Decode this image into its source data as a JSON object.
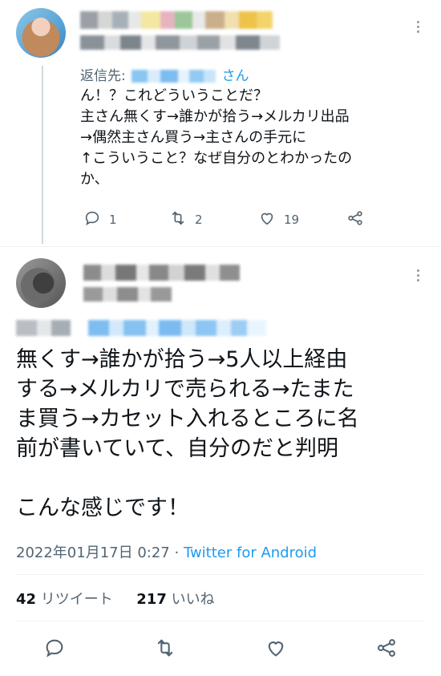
{
  "reply_tweet": {
    "reply_prefix": "返信先:",
    "reply_suffix": "さん",
    "text": "ん！？これどういうことだ？\n主さん無くす→誰かが拾う→メルカリ出品\n→偶然主さん買う→主さんの手元に\n↑こういうこと？なぜ自分のとわかったの\nか、",
    "actions": {
      "reply_count": "1",
      "retweet_count": "2",
      "like_count": "19"
    }
  },
  "main_tweet": {
    "text": "無くす→誰かが拾う→5人以上経由\nする→メルカリで売られる→たまた\nま買う→カセット入れるところに名\n前が書いていて、自分のだと判明\n\nこんな感じです！",
    "timestamp": "2022年01月17日 0:27 · ",
    "source": "Twitter for Android",
    "retweets_count": "42",
    "retweets_label": "リツイート",
    "likes_count": "217",
    "likes_label": "いいね"
  },
  "icons": {
    "reply": "reply-icon",
    "retweet": "retweet-icon",
    "like": "heart-icon",
    "share": "share-icon",
    "more": "more-vertical-icon"
  },
  "colors": {
    "text": "#0f1419",
    "secondary": "#536471",
    "link": "#1d9bf0",
    "divider": "#eff3f4",
    "thread_line": "#cfd9de"
  }
}
